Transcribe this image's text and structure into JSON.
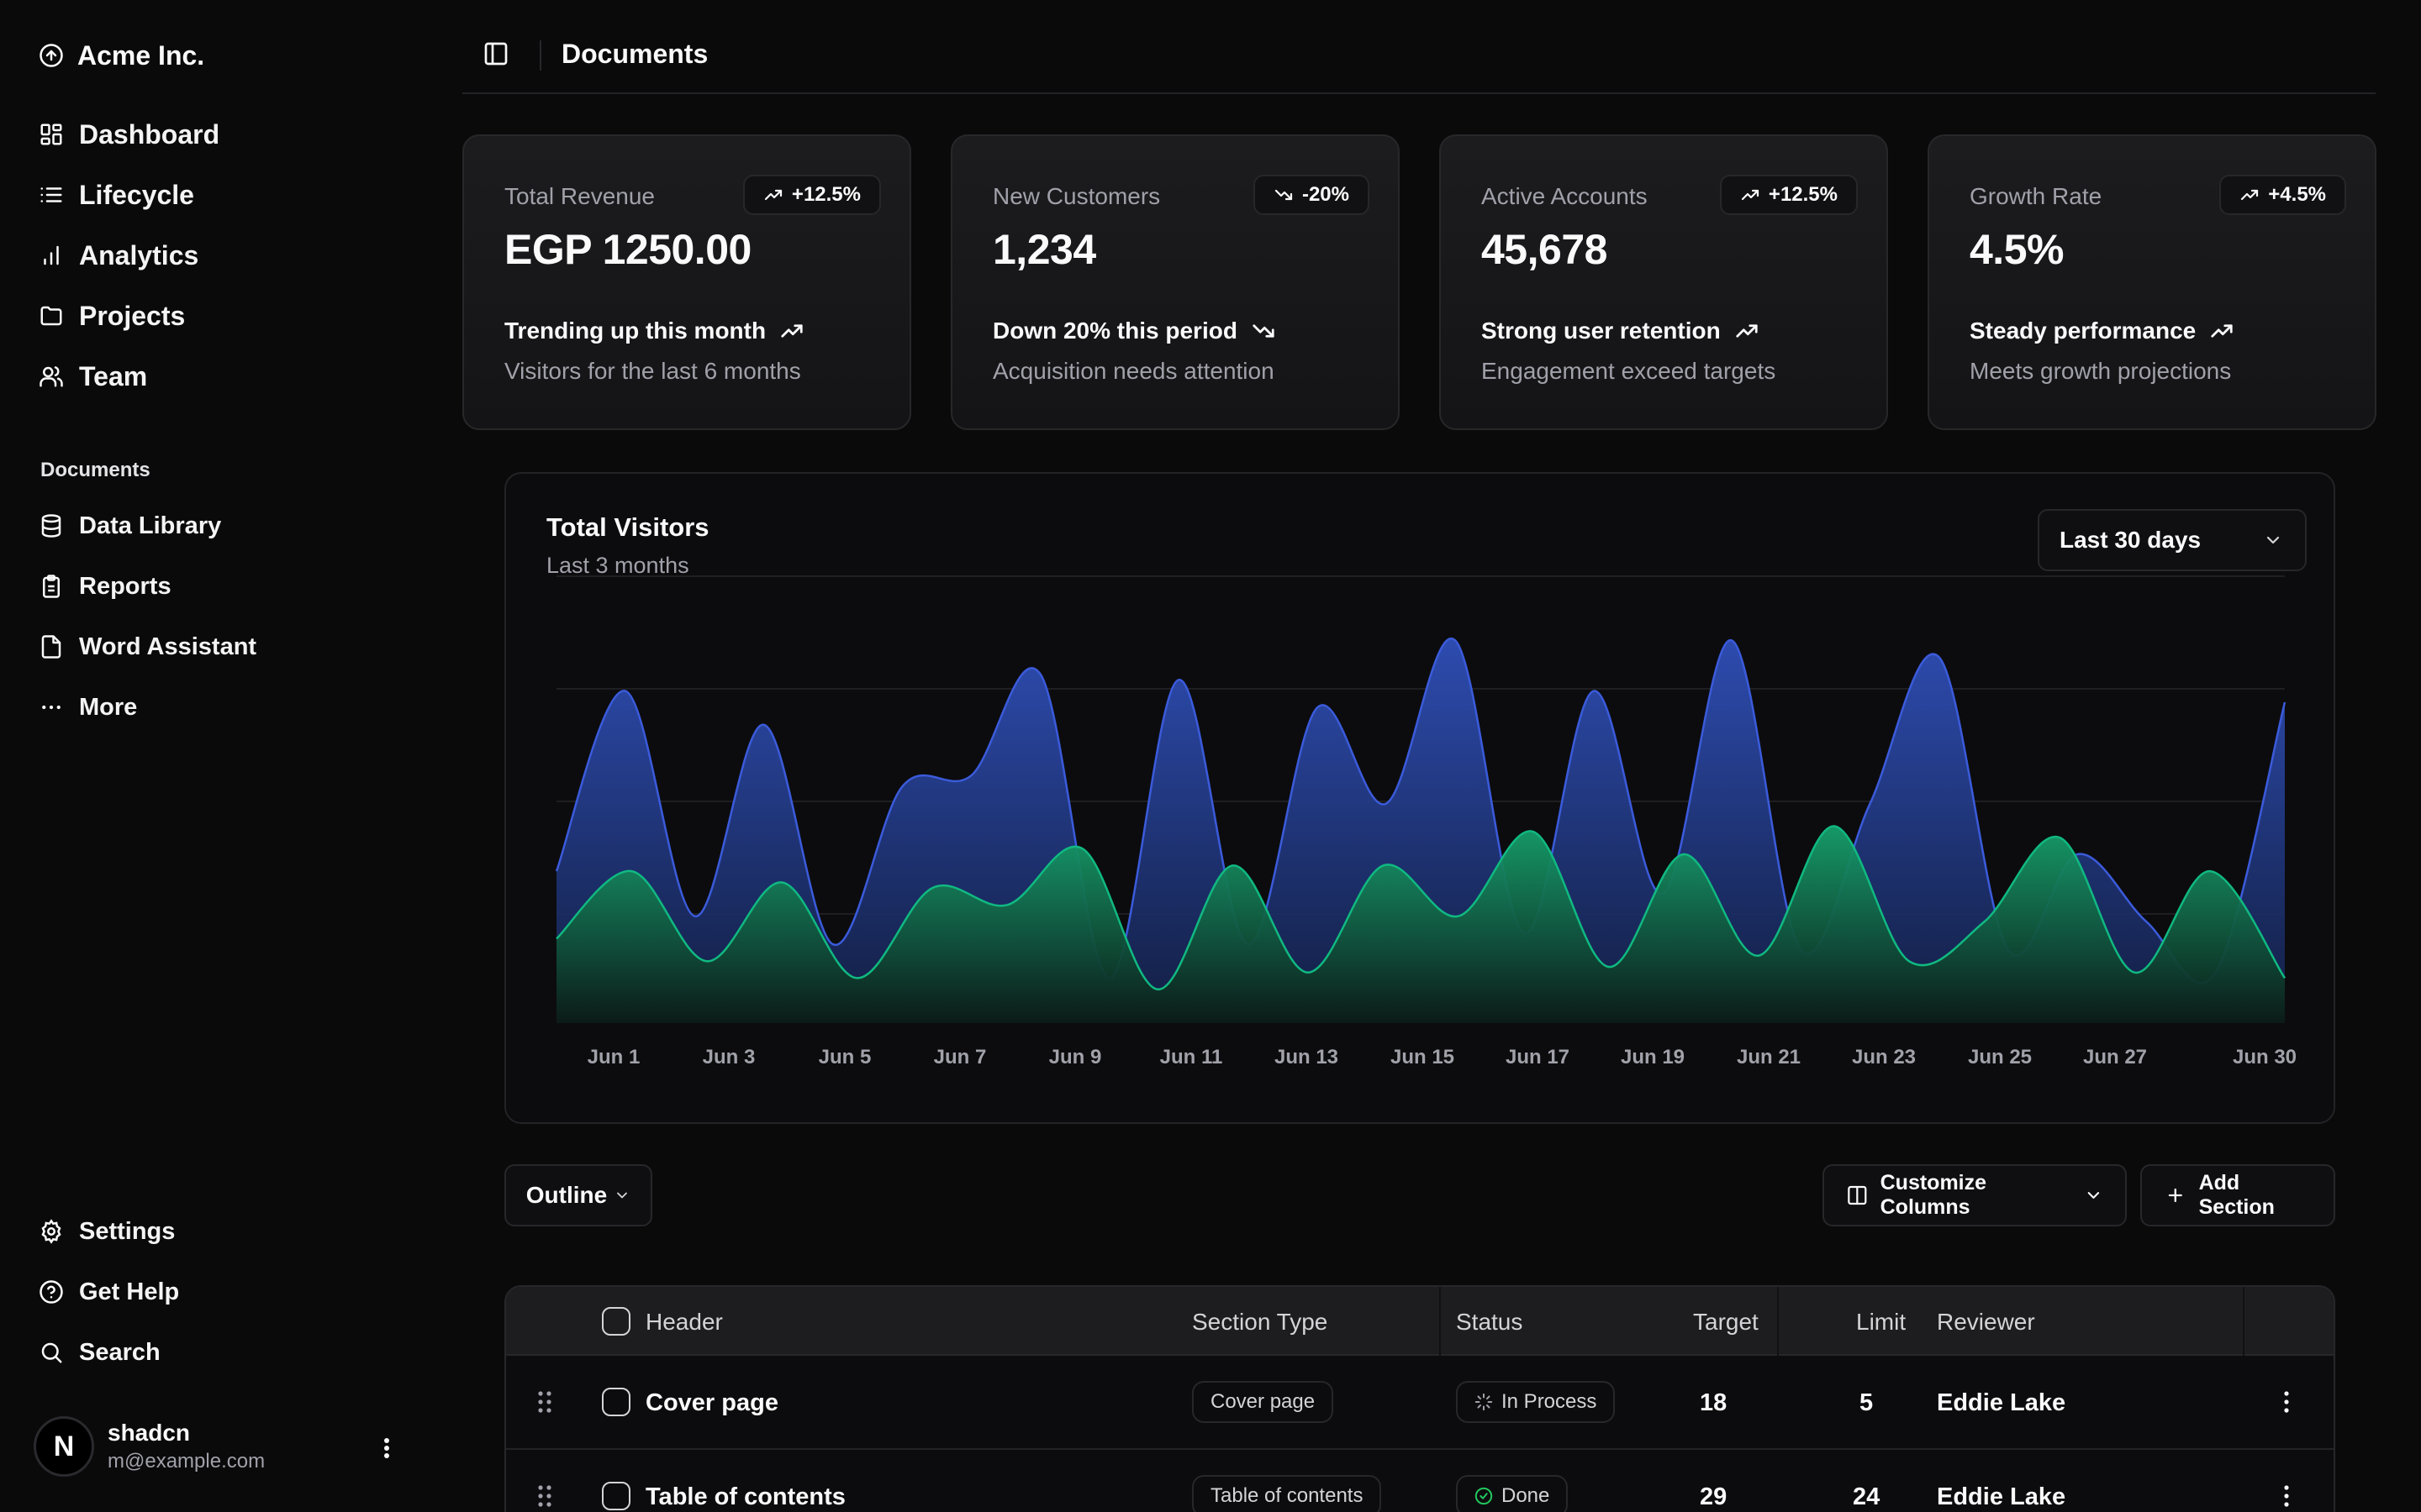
{
  "app": {
    "brand": "Acme Inc."
  },
  "sidebar": {
    "main_items": [
      {
        "label": "Dashboard",
        "icon": "dashboard-icon"
      },
      {
        "label": "Lifecycle",
        "icon": "list-icon"
      },
      {
        "label": "Analytics",
        "icon": "bar-chart-icon"
      },
      {
        "label": "Projects",
        "icon": "folder-icon"
      },
      {
        "label": "Team",
        "icon": "users-icon"
      }
    ],
    "documents_label": "Documents",
    "doc_items": [
      {
        "label": "Data Library",
        "icon": "database-icon"
      },
      {
        "label": "Reports",
        "icon": "clipboard-icon"
      },
      {
        "label": "Word Assistant",
        "icon": "file-icon"
      },
      {
        "label": "More",
        "icon": "more-icon"
      }
    ],
    "footer_items": [
      {
        "label": "Settings",
        "icon": "gear-icon"
      },
      {
        "label": "Get Help",
        "icon": "help-icon"
      },
      {
        "label": "Search",
        "icon": "search-icon"
      }
    ],
    "user": {
      "initial": "N",
      "name": "shadcn",
      "email": "m@example.com"
    }
  },
  "header": {
    "title": "Documents"
  },
  "cards": [
    {
      "title": "Total Revenue",
      "badge": "+12.5%",
      "value": "EGP 1250.00",
      "trend": "Trending up this month",
      "sub": "Visitors for the last 6 months",
      "direction": "up"
    },
    {
      "title": "New Customers",
      "badge": "-20%",
      "value": "1,234",
      "trend": "Down 20% this period",
      "sub": "Acquisition needs attention",
      "direction": "down"
    },
    {
      "title": "Active Accounts",
      "badge": "+12.5%",
      "value": "45,678",
      "trend": "Strong user retention",
      "sub": "Engagement exceed targets",
      "direction": "up"
    },
    {
      "title": "Growth Rate",
      "badge": "+4.5%",
      "value": "4.5%",
      "trend": "Steady performance",
      "sub": "Meets growth projections",
      "direction": "up"
    }
  ],
  "chart": {
    "title": "Total Visitors",
    "subtitle": "Last 3 months",
    "range_selected": "Last 30 days"
  },
  "chart_data": {
    "type": "area",
    "title": "Total Visitors",
    "subtitle": "Last 3 months",
    "x_ticks": [
      "Jun 1",
      "Jun 3",
      "Jun 5",
      "Jun 7",
      "Jun 9",
      "Jun 11",
      "Jun 13",
      "Jun 15",
      "Jun 17",
      "Jun 19",
      "Jun 21",
      "Jun 23",
      "Jun 25",
      "Jun 27",
      "Jun 30"
    ],
    "x": [
      "Jun 1",
      "Jun 2",
      "Jun 3",
      "Jun 4",
      "Jun 5",
      "Jun 6",
      "Jun 7",
      "Jun 8",
      "Jun 9",
      "Jun 10",
      "Jun 11",
      "Jun 12",
      "Jun 13",
      "Jun 14",
      "Jun 15",
      "Jun 16",
      "Jun 17",
      "Jun 18",
      "Jun 19",
      "Jun 20",
      "Jun 21",
      "Jun 22",
      "Jun 23",
      "Jun 24",
      "Jun 25",
      "Jun 26",
      "Jun 27",
      "Jun 28",
      "Jun 29",
      "Jun 30"
    ],
    "ylim": [
      0,
      400
    ],
    "grid": true,
    "series": [
      {
        "color": "#3b5bdb",
        "values": [
          135,
          295,
          95,
          265,
          70,
          210,
          220,
          310,
          40,
          305,
          70,
          280,
          195,
          340,
          80,
          295,
          115,
          340,
          65,
          195,
          325,
          65,
          150,
          90,
          45,
          285
        ],
        "stacked": true
      },
      {
        "color": "#10b981",
        "values": [
          75,
          135,
          55,
          125,
          40,
          120,
          105,
          155,
          30,
          140,
          45,
          140,
          95,
          170,
          50,
          150,
          60,
          175,
          55,
          90,
          165,
          45,
          135,
          40
        ]
      }
    ],
    "notes": ""
  },
  "toolbar": {
    "view_label": "Outline",
    "customize_label": "Customize Columns",
    "add_label": "Add Section"
  },
  "table": {
    "columns": [
      "Header",
      "Section Type",
      "Status",
      "Target",
      "Limit",
      "Reviewer"
    ],
    "rows": [
      {
        "header": "Cover page",
        "section_type": "Cover page",
        "status": "In Process",
        "status_icon": "loader-icon",
        "target": "18",
        "limit": "5",
        "reviewer": "Eddie Lake"
      },
      {
        "header": "Table of contents",
        "section_type": "Table of contents",
        "status": "Done",
        "status_icon": "check-circle-icon",
        "target": "29",
        "limit": "24",
        "reviewer": "Eddie Lake"
      }
    ]
  }
}
